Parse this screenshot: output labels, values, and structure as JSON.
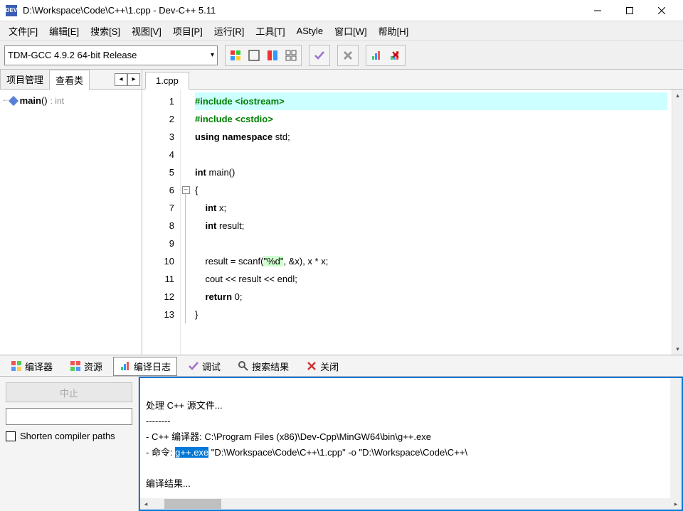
{
  "titlebar": {
    "app_icon_text": "DEV",
    "title": "D:\\Workspace\\Code\\C++\\1.cpp - Dev-C++ 5.11"
  },
  "menubar": [
    "文件[F]",
    "编辑[E]",
    "搜索[S]",
    "视图[V]",
    "项目[P]",
    "运行[R]",
    "工具[T]",
    "AStyle",
    "窗口[W]",
    "帮助[H]"
  ],
  "toolbar": {
    "compiler": "TDM-GCC 4.9.2 64-bit Release"
  },
  "sidebar": {
    "tabs": [
      "项目管理",
      "查看类"
    ],
    "active_tab": 1,
    "tree": {
      "fn": "main",
      "sig": "()",
      "ret": ": int"
    }
  },
  "editor": {
    "tab_label": "1.cpp",
    "lines": [
      {
        "n": 1,
        "html": "<span class='inc'>#include &lt;iostream&gt;</span>",
        "hl": true
      },
      {
        "n": 2,
        "html": "<span class='inc'>#include &lt;cstdio&gt;</span>"
      },
      {
        "n": 3,
        "html": "<span class='kw'>using</span> <span class='kw'>namespace</span> std;"
      },
      {
        "n": 4,
        "html": ""
      },
      {
        "n": 5,
        "html": "<span class='kw'>int</span> main()"
      },
      {
        "n": 6,
        "html": "{"
      },
      {
        "n": 7,
        "html": "    <span class='kw'>int</span> x;"
      },
      {
        "n": 8,
        "html": "    <span class='kw'>int</span> result;"
      },
      {
        "n": 9,
        "html": ""
      },
      {
        "n": 10,
        "html": "    result = scanf(<span class='str'>\"%d\"</span>, &amp;x), x * x;"
      },
      {
        "n": 11,
        "html": "    cout &lt;&lt; result &lt;&lt; endl;"
      },
      {
        "n": 12,
        "html": "    <span class='kw'>return</span> <span class='num'>0</span>;"
      },
      {
        "n": 13,
        "html": "}"
      }
    ]
  },
  "bottom": {
    "tabs": [
      {
        "label": "编译器",
        "icon": "compiler"
      },
      {
        "label": "资源",
        "icon": "resource"
      },
      {
        "label": "编译日志",
        "icon": "log",
        "active": true
      },
      {
        "label": "调试",
        "icon": "debug"
      },
      {
        "label": "搜索结果",
        "icon": "search-res"
      },
      {
        "label": "关闭",
        "icon": "close"
      }
    ],
    "abort_label": "中止",
    "shorten_label": "Shorten compiler paths",
    "log_lines": [
      "",
      "处理 C++ 源文件...",
      "--------",
      "- C++ 编译器: C:\\Program Files (x86)\\Dev-Cpp\\MinGW64\\bin\\g++.exe",
      {
        "prefix": "- 命令: ",
        "highlight": "g++.exe",
        "suffix": " \"D:\\Workspace\\Code\\C++\\1.cpp\" -o \"D:\\Workspace\\Code\\C++\\"
      },
      "",
      "编译结果...",
      "--------"
    ]
  }
}
